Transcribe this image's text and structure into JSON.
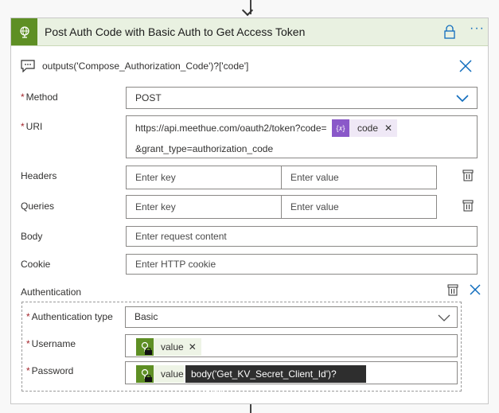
{
  "action": {
    "title": "Post Auth Code with Basic Auth to Get Access Token"
  },
  "output_link": "outputs('Compose_Authorization_Code')?['code']",
  "fields": {
    "method": {
      "label": "Method",
      "value": "POST"
    },
    "uri": {
      "label": "URI",
      "line1": "https://api.meethue.com/oauth2/token?code=",
      "token": "code",
      "line2": "&grant_type=authorization_code"
    },
    "headers": {
      "label": "Headers",
      "key_placeholder": "Enter key",
      "value_placeholder": "Enter value"
    },
    "queries": {
      "label": "Queries",
      "key_placeholder": "Enter key",
      "value_placeholder": "Enter value"
    },
    "body": {
      "label": "Body",
      "placeholder": "Enter request content"
    },
    "cookie": {
      "label": "Cookie",
      "placeholder": "Enter HTTP cookie"
    }
  },
  "authentication": {
    "label": "Authentication",
    "type": {
      "label": "Authentication type",
      "value": "Basic"
    },
    "username": {
      "label": "Username",
      "token": "value"
    },
    "password": {
      "label": "Password",
      "token": "value"
    },
    "tooltip": "body('Get_KV_Secret_Client_Id')?['value']"
  },
  "required_marker": "*",
  "icons": {
    "header": "globe-icon",
    "lock": "lock-icon",
    "more": "more-icon",
    "output": "comment-icon",
    "close": "close-icon",
    "chevron": "chevron-down-icon",
    "delete": "delete-icon",
    "expression": "expression-icon"
  },
  "colors": {
    "header_bg": "#e9f1e1",
    "header_icon_bg": "#5e8f24",
    "accent_blue": "#0f6cbd",
    "expression_purple": "#8a58c9",
    "token_purple_bg": "#efe8f6",
    "required_red": "#a4262c"
  }
}
